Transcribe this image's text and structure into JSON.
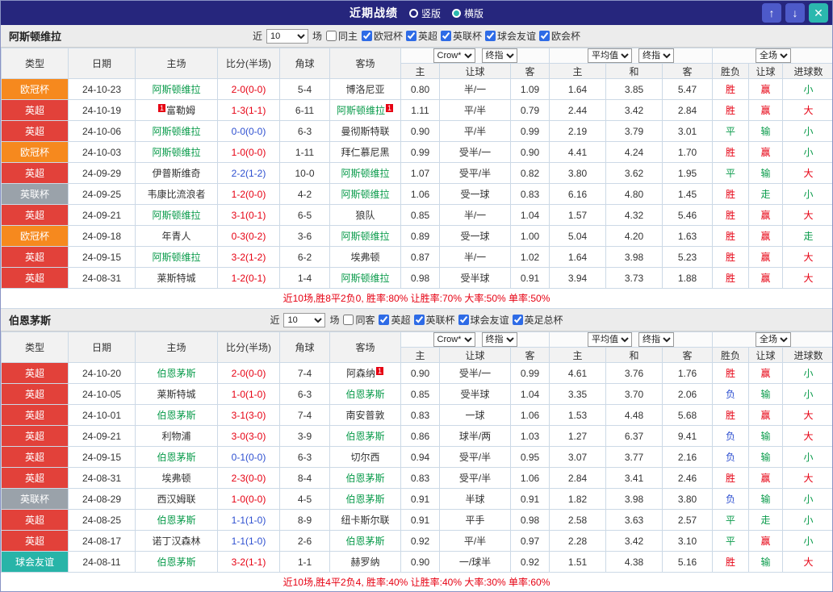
{
  "topbar": {
    "title": "近期战绩",
    "radio_vertical": "竖版",
    "radio_horizontal": "横版",
    "up_icon": "↑",
    "down_icon": "↓",
    "close_icon": "✕"
  },
  "labels": {
    "recent_prefix": "近",
    "recent_value": "10",
    "recent_suffix": "场"
  },
  "selects": {
    "bookmaker": "Crow*",
    "final": "终指",
    "average": "平均值",
    "scope": "全场"
  },
  "columns": {
    "type": "类型",
    "date": "日期",
    "home": "主场",
    "score": "比分(半场)",
    "corner": "角球",
    "away": "客场",
    "asian_home": "主",
    "asian_line": "让球",
    "asian_away": "客",
    "euro_home": "主",
    "euro_draw": "和",
    "euro_away": "客",
    "result": "胜负",
    "handicap": "让球",
    "goals": "进球数"
  },
  "villa": {
    "name": "阿斯顿维拉",
    "venue_filter": "同主",
    "leagues": [
      "欧冠杯",
      "英超",
      "英联杯",
      "球会友谊",
      "欧会杯"
    ],
    "summary": "近10场,胜8平2负0, 胜率:80% 让胜率:70% 大率:50% 单率:50%",
    "rows": [
      {
        "type": "欧冠杯",
        "tcolor": "orange",
        "date": "24-10-23",
        "home": {
          "name": "阿斯顿维拉",
          "focus": true
        },
        "score": {
          "text": "2-0(0-0)",
          "color": "red"
        },
        "corner": "5-4",
        "away": {
          "name": "博洛尼亚"
        },
        "odds": [
          "0.80",
          "半/一",
          "1.09"
        ],
        "euro": [
          "1.64",
          "3.85",
          "5.47"
        ],
        "result": {
          "text": "胜",
          "color": "red"
        },
        "handicap": {
          "text": "赢",
          "color": "red"
        },
        "goals": {
          "text": "小",
          "color": "green"
        }
      },
      {
        "type": "英超",
        "tcolor": "red",
        "date": "24-10-19",
        "home": {
          "name": "富勒姆",
          "badge_left": "1"
        },
        "score": {
          "text": "1-3(1-1)",
          "color": "red"
        },
        "corner": "6-11",
        "away": {
          "name": "阿斯顿维拉",
          "focus": true,
          "badge_right": "1"
        },
        "odds": [
          "1.11",
          "平/半",
          "0.79"
        ],
        "euro": [
          "2.44",
          "3.42",
          "2.84"
        ],
        "result": {
          "text": "胜",
          "color": "red"
        },
        "handicap": {
          "text": "赢",
          "color": "red"
        },
        "goals": {
          "text": "大",
          "color": "red"
        }
      },
      {
        "type": "英超",
        "tcolor": "red",
        "date": "24-10-06",
        "home": {
          "name": "阿斯顿维拉",
          "focus": true
        },
        "score": {
          "text": "0-0(0-0)",
          "color": "blue"
        },
        "corner": "6-3",
        "away": {
          "name": "曼彻斯特联"
        },
        "odds": [
          "0.90",
          "平/半",
          "0.99"
        ],
        "euro": [
          "2.19",
          "3.79",
          "3.01"
        ],
        "result": {
          "text": "平",
          "color": "green"
        },
        "handicap": {
          "text": "输",
          "color": "green"
        },
        "goals": {
          "text": "小",
          "color": "green"
        }
      },
      {
        "type": "欧冠杯",
        "tcolor": "orange",
        "date": "24-10-03",
        "home": {
          "name": "阿斯顿维拉",
          "focus": true
        },
        "score": {
          "text": "1-0(0-0)",
          "color": "red"
        },
        "corner": "1-11",
        "away": {
          "name": "拜仁慕尼黑"
        },
        "odds": [
          "0.99",
          "受半/一",
          "0.90"
        ],
        "euro": [
          "4.41",
          "4.24",
          "1.70"
        ],
        "result": {
          "text": "胜",
          "color": "red"
        },
        "handicap": {
          "text": "赢",
          "color": "red"
        },
        "goals": {
          "text": "小",
          "color": "green"
        }
      },
      {
        "type": "英超",
        "tcolor": "red",
        "date": "24-09-29",
        "home": {
          "name": "伊普斯维奇"
        },
        "score": {
          "text": "2-2(1-2)",
          "color": "blue"
        },
        "corner": "10-0",
        "away": {
          "name": "阿斯顿维拉",
          "focus": true
        },
        "odds": [
          "1.07",
          "受平/半",
          "0.82"
        ],
        "euro": [
          "3.80",
          "3.62",
          "1.95"
        ],
        "result": {
          "text": "平",
          "color": "green"
        },
        "handicap": {
          "text": "输",
          "color": "green"
        },
        "goals": {
          "text": "大",
          "color": "red"
        }
      },
      {
        "type": "英联杯",
        "tcolor": "gray",
        "date": "24-09-25",
        "home": {
          "name": "韦康比流浪者"
        },
        "score": {
          "text": "1-2(0-0)",
          "color": "red"
        },
        "corner": "4-2",
        "away": {
          "name": "阿斯顿维拉",
          "focus": true
        },
        "odds": [
          "1.06",
          "受一球",
          "0.83"
        ],
        "euro": [
          "6.16",
          "4.80",
          "1.45"
        ],
        "result": {
          "text": "胜",
          "color": "red"
        },
        "handicap": {
          "text": "走",
          "color": "green"
        },
        "goals": {
          "text": "小",
          "color": "green"
        }
      },
      {
        "type": "英超",
        "tcolor": "red",
        "date": "24-09-21",
        "home": {
          "name": "阿斯顿维拉",
          "focus": true
        },
        "score": {
          "text": "3-1(0-1)",
          "color": "red"
        },
        "corner": "6-5",
        "away": {
          "name": "狼队"
        },
        "odds": [
          "0.85",
          "半/一",
          "1.04"
        ],
        "euro": [
          "1.57",
          "4.32",
          "5.46"
        ],
        "result": {
          "text": "胜",
          "color": "red"
        },
        "handicap": {
          "text": "赢",
          "color": "red"
        },
        "goals": {
          "text": "大",
          "color": "red"
        }
      },
      {
        "type": "欧冠杯",
        "tcolor": "orange",
        "date": "24-09-18",
        "home": {
          "name": "年青人"
        },
        "score": {
          "text": "0-3(0-2)",
          "color": "red"
        },
        "corner": "3-6",
        "away": {
          "name": "阿斯顿维拉",
          "focus": true
        },
        "odds": [
          "0.89",
          "受一球",
          "1.00"
        ],
        "euro": [
          "5.04",
          "4.20",
          "1.63"
        ],
        "result": {
          "text": "胜",
          "color": "red"
        },
        "handicap": {
          "text": "赢",
          "color": "red"
        },
        "goals": {
          "text": "走",
          "color": "green"
        }
      },
      {
        "type": "英超",
        "tcolor": "red",
        "date": "24-09-15",
        "home": {
          "name": "阿斯顿维拉",
          "focus": true
        },
        "score": {
          "text": "3-2(1-2)",
          "color": "red"
        },
        "corner": "6-2",
        "away": {
          "name": "埃弗顿"
        },
        "odds": [
          "0.87",
          "半/一",
          "1.02"
        ],
        "euro": [
          "1.64",
          "3.98",
          "5.23"
        ],
        "result": {
          "text": "胜",
          "color": "red"
        },
        "handicap": {
          "text": "赢",
          "color": "red"
        },
        "goals": {
          "text": "大",
          "color": "red"
        }
      },
      {
        "type": "英超",
        "tcolor": "red",
        "date": "24-08-31",
        "home": {
          "name": "莱斯特城"
        },
        "score": {
          "text": "1-2(0-1)",
          "color": "red"
        },
        "corner": "1-4",
        "away": {
          "name": "阿斯顿维拉",
          "focus": true
        },
        "odds": [
          "0.98",
          "受半球",
          "0.91"
        ],
        "euro": [
          "3.94",
          "3.73",
          "1.88"
        ],
        "result": {
          "text": "胜",
          "color": "red"
        },
        "handicap": {
          "text": "赢",
          "color": "red"
        },
        "goals": {
          "text": "大",
          "color": "red"
        }
      }
    ]
  },
  "bournemouth": {
    "name": "伯恩茅斯",
    "venue_filter": "同客",
    "leagues": [
      "英超",
      "英联杯",
      "球会友谊",
      "英足总杯"
    ],
    "summary": "近10场,胜4平2负4, 胜率:40% 让胜率:40% 大率:30% 单率:60%",
    "rows": [
      {
        "type": "英超",
        "tcolor": "red",
        "date": "24-10-20",
        "home": {
          "name": "伯恩茅斯",
          "focus": true
        },
        "score": {
          "text": "2-0(0-0)",
          "color": "red"
        },
        "corner": "7-4",
        "away": {
          "name": "阿森纳",
          "badge_right": "1"
        },
        "odds": [
          "0.90",
          "受半/一",
          "0.99"
        ],
        "euro": [
          "4.61",
          "3.76",
          "1.76"
        ],
        "result": {
          "text": "胜",
          "color": "red"
        },
        "handicap": {
          "text": "赢",
          "color": "red"
        },
        "goals": {
          "text": "小",
          "color": "green"
        }
      },
      {
        "type": "英超",
        "tcolor": "red",
        "date": "24-10-05",
        "home": {
          "name": "莱斯特城"
        },
        "score": {
          "text": "1-0(1-0)",
          "color": "red"
        },
        "corner": "6-3",
        "away": {
          "name": "伯恩茅斯",
          "focus": true
        },
        "odds": [
          "0.85",
          "受半球",
          "1.04"
        ],
        "euro": [
          "3.35",
          "3.70",
          "2.06"
        ],
        "result": {
          "text": "负",
          "color": "blue"
        },
        "handicap": {
          "text": "输",
          "color": "green"
        },
        "goals": {
          "text": "小",
          "color": "green"
        }
      },
      {
        "type": "英超",
        "tcolor": "red",
        "date": "24-10-01",
        "home": {
          "name": "伯恩茅斯",
          "focus": true
        },
        "score": {
          "text": "3-1(3-0)",
          "color": "red"
        },
        "corner": "7-4",
        "away": {
          "name": "南安普敦"
        },
        "odds": [
          "0.83",
          "一球",
          "1.06"
        ],
        "euro": [
          "1.53",
          "4.48",
          "5.68"
        ],
        "result": {
          "text": "胜",
          "color": "red"
        },
        "handicap": {
          "text": "赢",
          "color": "red"
        },
        "goals": {
          "text": "大",
          "color": "red"
        }
      },
      {
        "type": "英超",
        "tcolor": "red",
        "date": "24-09-21",
        "home": {
          "name": "利物浦"
        },
        "score": {
          "text": "3-0(3-0)",
          "color": "red"
        },
        "corner": "3-9",
        "away": {
          "name": "伯恩茅斯",
          "focus": true
        },
        "odds": [
          "0.86",
          "球半/两",
          "1.03"
        ],
        "euro": [
          "1.27",
          "6.37",
          "9.41"
        ],
        "result": {
          "text": "负",
          "color": "blue"
        },
        "handicap": {
          "text": "输",
          "color": "green"
        },
        "goals": {
          "text": "大",
          "color": "red"
        }
      },
      {
        "type": "英超",
        "tcolor": "red",
        "date": "24-09-15",
        "home": {
          "name": "伯恩茅斯",
          "focus": true
        },
        "score": {
          "text": "0-1(0-0)",
          "color": "blue"
        },
        "corner": "6-3",
        "away": {
          "name": "切尔西"
        },
        "odds": [
          "0.94",
          "受平/半",
          "0.95"
        ],
        "euro": [
          "3.07",
          "3.77",
          "2.16"
        ],
        "result": {
          "text": "负",
          "color": "blue"
        },
        "handicap": {
          "text": "输",
          "color": "green"
        },
        "goals": {
          "text": "小",
          "color": "green"
        }
      },
      {
        "type": "英超",
        "tcolor": "red",
        "date": "24-08-31",
        "home": {
          "name": "埃弗顿"
        },
        "score": {
          "text": "2-3(0-0)",
          "color": "red"
        },
        "corner": "8-4",
        "away": {
          "name": "伯恩茅斯",
          "focus": true
        },
        "odds": [
          "0.83",
          "受平/半",
          "1.06"
        ],
        "euro": [
          "2.84",
          "3.41",
          "2.46"
        ],
        "result": {
          "text": "胜",
          "color": "red"
        },
        "handicap": {
          "text": "赢",
          "color": "red"
        },
        "goals": {
          "text": "大",
          "color": "red"
        }
      },
      {
        "type": "英联杯",
        "tcolor": "gray",
        "date": "24-08-29",
        "home": {
          "name": "西汉姆联"
        },
        "score": {
          "text": "1-0(0-0)",
          "color": "red"
        },
        "corner": "4-5",
        "away": {
          "name": "伯恩茅斯",
          "focus": true
        },
        "odds": [
          "0.91",
          "半球",
          "0.91"
        ],
        "euro": [
          "1.82",
          "3.98",
          "3.80"
        ],
        "result": {
          "text": "负",
          "color": "blue"
        },
        "handicap": {
          "text": "输",
          "color": "green"
        },
        "goals": {
          "text": "小",
          "color": "green"
        }
      },
      {
        "type": "英超",
        "tcolor": "red",
        "date": "24-08-25",
        "home": {
          "name": "伯恩茅斯",
          "focus": true
        },
        "score": {
          "text": "1-1(1-0)",
          "color": "blue"
        },
        "corner": "8-9",
        "away": {
          "name": "纽卡斯尔联"
        },
        "odds": [
          "0.91",
          "平手",
          "0.98"
        ],
        "euro": [
          "2.58",
          "3.63",
          "2.57"
        ],
        "result": {
          "text": "平",
          "color": "green"
        },
        "handicap": {
          "text": "走",
          "color": "green"
        },
        "goals": {
          "text": "小",
          "color": "green"
        }
      },
      {
        "type": "英超",
        "tcolor": "red",
        "date": "24-08-17",
        "home": {
          "name": "诺丁汉森林"
        },
        "score": {
          "text": "1-1(1-0)",
          "color": "blue"
        },
        "corner": "2-6",
        "away": {
          "name": "伯恩茅斯",
          "focus": true
        },
        "odds": [
          "0.92",
          "平/半",
          "0.97"
        ],
        "euro": [
          "2.28",
          "3.42",
          "3.10"
        ],
        "result": {
          "text": "平",
          "color": "green"
        },
        "handicap": {
          "text": "赢",
          "color": "red"
        },
        "goals": {
          "text": "小",
          "color": "green"
        }
      },
      {
        "type": "球会友谊",
        "tcolor": "teal",
        "date": "24-08-11",
        "home": {
          "name": "伯恩茅斯",
          "focus": true
        },
        "score": {
          "text": "3-2(1-1)",
          "color": "red"
        },
        "corner": "1-1",
        "away": {
          "name": "赫罗纳"
        },
        "odds": [
          "0.90",
          "一/球半",
          "0.92"
        ],
        "euro": [
          "1.51",
          "4.38",
          "5.16"
        ],
        "result": {
          "text": "胜",
          "color": "red"
        },
        "handicap": {
          "text": "输",
          "color": "green"
        },
        "goals": {
          "text": "大",
          "color": "red"
        }
      }
    ]
  }
}
